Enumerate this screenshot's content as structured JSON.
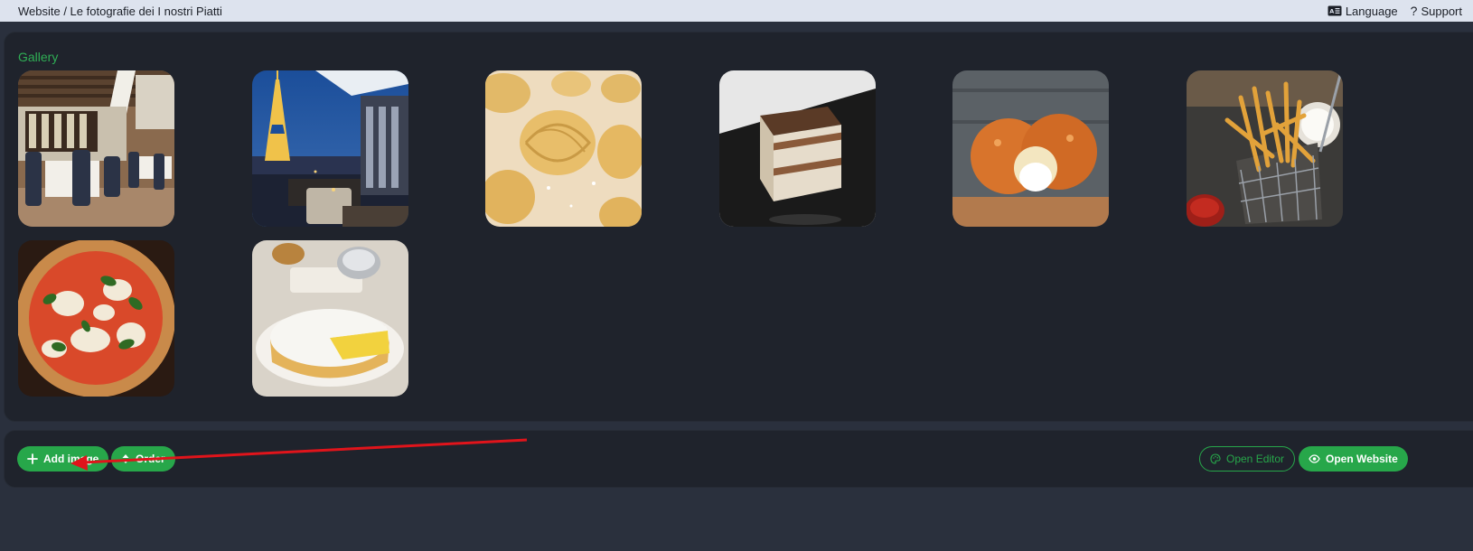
{
  "header": {
    "breadcrumb": "Website / Le fotografie dei I nostri Piatti",
    "language_label": "Language",
    "support_label": "Support",
    "language_icon": "language-badge-icon",
    "support_icon": "question-mark-icon"
  },
  "gallery": {
    "title": "Gallery",
    "images": [
      {
        "subject": "restaurant-interior"
      },
      {
        "subject": "eiffel-tower-terrace"
      },
      {
        "subject": "fresh-pasta-nests"
      },
      {
        "subject": "tiramisu"
      },
      {
        "subject": "arancini"
      },
      {
        "subject": "french-fries-basket"
      },
      {
        "subject": "margherita-pizza"
      },
      {
        "subject": "custard-tart"
      }
    ]
  },
  "actions": {
    "add_image_label": "Add image",
    "order_label": "Order",
    "open_editor_label": "Open Editor",
    "open_website_label": "Open Website"
  },
  "colors": {
    "accent_green": "#27a74a",
    "panel_bg": "#1f232c",
    "page_bg": "#2a303d",
    "topbar_bg": "#dde3ee",
    "annotation_arrow": "#e0141b"
  }
}
